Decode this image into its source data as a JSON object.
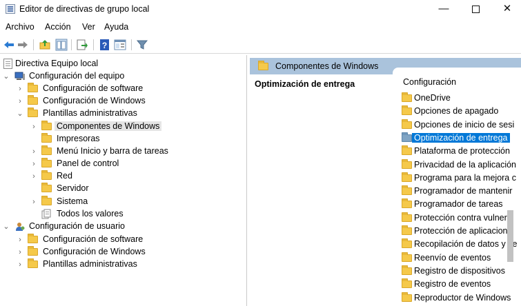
{
  "window": {
    "title": "Editor de directivas de grupo local",
    "minimize": "—",
    "close": "✕"
  },
  "menu": [
    "Archivo",
    "Acción",
    "Ver",
    "Ayuda"
  ],
  "tree": {
    "root": "Directiva Equipo local",
    "computer_config": "Configuración del equipo",
    "cc_software": "Configuración de software",
    "cc_windows": "Configuración de Windows",
    "cc_admin": "Plantillas administrativas",
    "admin_items": [
      "Componentes de Windows",
      "Impresoras",
      "Menú Inicio y barra de tareas",
      "Panel de control",
      "Red",
      "Servidor",
      "Sistema",
      "Todos los valores"
    ],
    "user_config": "Configuración de usuario",
    "uc_software": "Configuración de software",
    "uc_windows": "Configuración de Windows",
    "uc_admin": "Plantillas administrativas"
  },
  "right": {
    "header": "Componentes de Windows",
    "selected_title": "Optimización de entrega",
    "column_header": "Configuración",
    "items": [
      "OneDrive",
      "Opciones de apagado",
      "Opciones de inicio de sesi",
      "Optimización de entrega",
      "Plataforma de protección",
      "Privacidad de la aplicación",
      "Programa para la mejora c",
      "Programador de mantenir",
      "Programador de tareas",
      "Protección contra vulnera",
      "Protección de aplicacione",
      "Recopilación de datos y ve",
      "Reenvío de eventos",
      "Registro de dispositivos",
      "Registro de eventos",
      "Reproductor de Windows"
    ],
    "selected_index": 3
  },
  "colors": {
    "header_bg": "#aac3dc",
    "selection": "#0078d7",
    "folder": "#f5c94a"
  }
}
